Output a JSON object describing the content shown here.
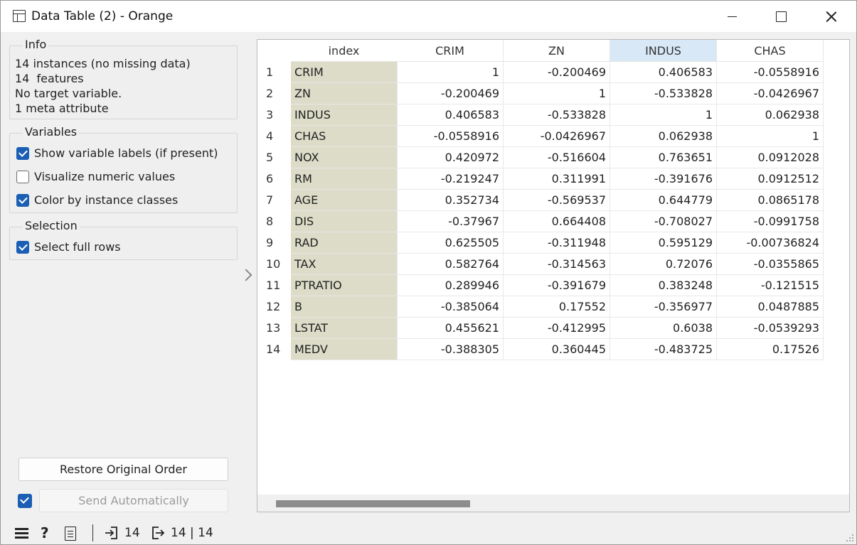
{
  "window": {
    "title": "Data Table (2) - Orange"
  },
  "info": {
    "title": "Info",
    "lines": [
      "14 instances (no missing data)",
      "14  features",
      "No target variable.",
      "1 meta attribute"
    ]
  },
  "variables": {
    "title": "Variables",
    "options": [
      {
        "label": "Show variable labels (if present)",
        "checked": true
      },
      {
        "label": "Visualize numeric values",
        "checked": false
      },
      {
        "label": "Color by instance classes",
        "checked": true
      }
    ]
  },
  "selection": {
    "title": "Selection",
    "options": [
      {
        "label": "Select full rows",
        "checked": true
      }
    ]
  },
  "buttons": {
    "restore": "Restore Original Order",
    "send": "Send Automatically",
    "send_auto_checked": true
  },
  "table": {
    "columns": [
      "index",
      "CRIM",
      "ZN",
      "INDUS",
      "CHAS"
    ],
    "selected_column": "INDUS",
    "meta_color": "#dcdcc8",
    "rows": [
      {
        "n": "1",
        "cells": [
          "CRIM",
          "1",
          "-0.200469",
          "0.406583",
          "-0.0558916"
        ]
      },
      {
        "n": "2",
        "cells": [
          "ZN",
          "-0.200469",
          "1",
          "-0.533828",
          "-0.0426967"
        ]
      },
      {
        "n": "3",
        "cells": [
          "INDUS",
          "0.406583",
          "-0.533828",
          "1",
          "0.062938"
        ]
      },
      {
        "n": "4",
        "cells": [
          "CHAS",
          "-0.0558916",
          "-0.0426967",
          "0.062938",
          "1"
        ]
      },
      {
        "n": "5",
        "cells": [
          "NOX",
          "0.420972",
          "-0.516604",
          "0.763651",
          "0.0912028"
        ]
      },
      {
        "n": "6",
        "cells": [
          "RM",
          "-0.219247",
          "0.311991",
          "-0.391676",
          "0.0912512"
        ]
      },
      {
        "n": "7",
        "cells": [
          "AGE",
          "0.352734",
          "-0.569537",
          "0.644779",
          "0.0865178"
        ]
      },
      {
        "n": "8",
        "cells": [
          "DIS",
          "-0.37967",
          "0.664408",
          "-0.708027",
          "-0.0991758"
        ]
      },
      {
        "n": "9",
        "cells": [
          "RAD",
          "0.625505",
          "-0.311948",
          "0.595129",
          "-0.00736824"
        ]
      },
      {
        "n": "10",
        "cells": [
          "TAX",
          "0.582764",
          "-0.314563",
          "0.72076",
          "-0.0355865"
        ]
      },
      {
        "n": "11",
        "cells": [
          "PTRATIO",
          "0.289946",
          "-0.391679",
          "0.383248",
          "-0.121515"
        ]
      },
      {
        "n": "12",
        "cells": [
          "B",
          "-0.385064",
          "0.17552",
          "-0.356977",
          "0.0487885"
        ]
      },
      {
        "n": "13",
        "cells": [
          "LSTAT",
          "0.455621",
          "-0.412995",
          "0.6038",
          "-0.0539293"
        ]
      },
      {
        "n": "14",
        "cells": [
          "MEDV",
          "-0.388305",
          "0.360445",
          "-0.483725",
          "0.17526"
        ]
      }
    ]
  },
  "status": {
    "input_count": "14",
    "output_count": "14 | 14"
  }
}
